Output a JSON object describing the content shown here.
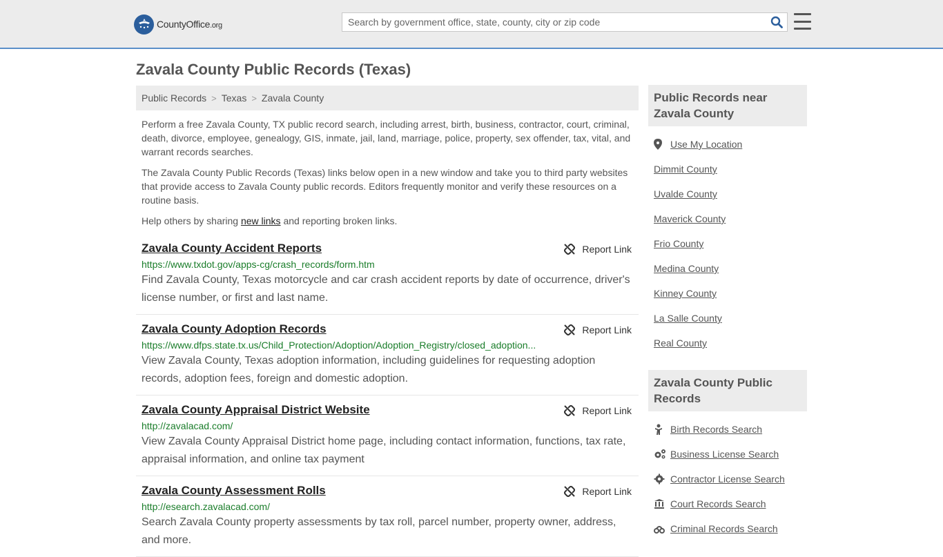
{
  "header": {
    "logo_main": "CountyOffice",
    "logo_suffix": ".org",
    "search_placeholder": "Search by government office, state, county, city or zip code"
  },
  "page_title": "Zavala County Public Records (Texas)",
  "breadcrumb": [
    "Public Records",
    "Texas",
    "Zavala County"
  ],
  "intro": {
    "p1": "Perform a free Zavala County, TX public record search, including arrest, birth, business, contractor, court, criminal, death, divorce, employee, genealogy, GIS, inmate, jail, land, marriage, police, property, sex offender, tax, vital, and warrant records searches.",
    "p2": "The Zavala County Public Records (Texas) links below open in a new window and take you to third party websites that provide access to Zavala County public records. Editors frequently monitor and verify these resources on a routine basis.",
    "p3_before": "Help others by sharing ",
    "p3_link": "new links",
    "p3_after": " and reporting broken links."
  },
  "report_label": "Report Link",
  "records": [
    {
      "title": "Zavala County Accident Reports",
      "url": "https://www.txdot.gov/apps-cg/crash_records/form.htm",
      "desc": "Find Zavala County, Texas motorcycle and car crash accident reports by date of occurrence, driver's license number, or first and last name."
    },
    {
      "title": "Zavala County Adoption Records",
      "url": "https://www.dfps.state.tx.us/Child_Protection/Adoption/Adoption_Registry/closed_adoption...",
      "desc": "View Zavala County, Texas adoption information, including guidelines for requesting adoption records, adoption fees, foreign and domestic adoption."
    },
    {
      "title": "Zavala County Appraisal District Website",
      "url": "http://zavalacad.com/",
      "desc": "View Zavala County Appraisal District home page, including contact information, functions, tax rate, appraisal information, and online tax payment"
    },
    {
      "title": "Zavala County Assessment Rolls",
      "url": "http://esearch.zavalacad.com/",
      "desc": "Search Zavala County property assessments by tax roll, parcel number, property owner, address, and more."
    }
  ],
  "sidebar": {
    "near_title": "Public Records near Zavala County",
    "use_location": "Use My Location",
    "nearby": [
      "Dimmit County",
      "Uvalde County",
      "Maverick County",
      "Frio County",
      "Medina County",
      "Kinney County",
      "La Salle County",
      "Real County"
    ],
    "county_title": "Zavala County Public Records",
    "county_links": [
      {
        "label": "Birth Records Search",
        "icon": "baby-icon"
      },
      {
        "label": "Business License Search",
        "icon": "gears-icon"
      },
      {
        "label": "Contractor License Search",
        "icon": "gear-icon"
      },
      {
        "label": "Court Records Search",
        "icon": "courthouse-icon"
      },
      {
        "label": "Criminal Records Search",
        "icon": "handcuffs-icon"
      }
    ]
  },
  "colors": {
    "accent": "#2b5e9c",
    "url_green": "#1a7d2a",
    "header_bg": "#ececec"
  }
}
